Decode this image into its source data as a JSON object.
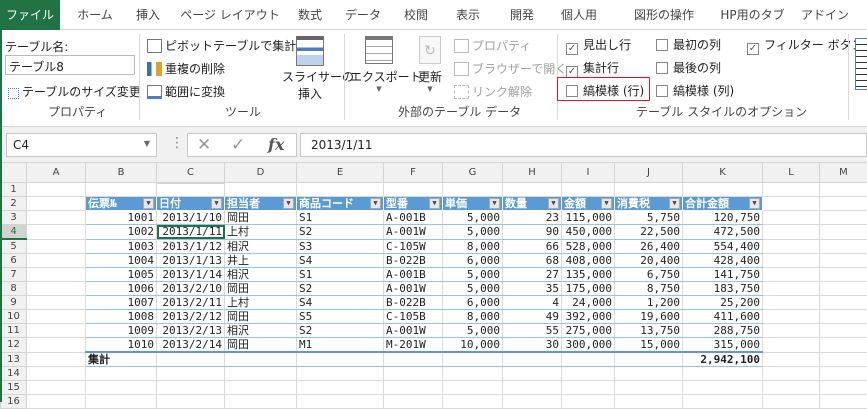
{
  "tabs": [
    "ファイル",
    "ホーム",
    "挿入",
    "ページ レイアウト",
    "数式",
    "データ",
    "校閲",
    "表示",
    "開発",
    "個人用",
    "図形の操作",
    "HP用のタブ",
    "アドイン"
  ],
  "ribbon": {
    "properties": {
      "table_name_label": "テーブル名:",
      "table_name_value": "テーブル8",
      "resize": "テーブルのサイズ変更",
      "group": "プロパティ"
    },
    "tools": {
      "pivot": "ピボットテーブルで集計",
      "dedupe": "重複の削除",
      "convert": "範囲に変換",
      "slicer_line1": "スライサーの",
      "slicer_line2": "挿入",
      "group": "ツール"
    },
    "external": {
      "export": "エクスポート",
      "refresh": "更新",
      "properties": "プロパティ",
      "open_browser": "ブラウザーで開く",
      "unlink": "リンク解除",
      "group": "外部のテーブル データ"
    },
    "style_options": {
      "header_row": {
        "label": "見出し行",
        "checked": true
      },
      "total_row": {
        "label": "集計行",
        "checked": true
      },
      "banded_rows": {
        "label": "縞模様 (行)",
        "checked": false
      },
      "first_column": {
        "label": "最初の列",
        "checked": false
      },
      "last_column": {
        "label": "最後の列",
        "checked": false
      },
      "banded_columns": {
        "label": "縞模様 (列)",
        "checked": false
      },
      "filter_button": {
        "label": "フィルター ボタン",
        "checked": true
      },
      "group": "テーブル スタイルのオプション"
    }
  },
  "formula_bar": {
    "name_box": "C4",
    "cancel": "✕",
    "enter": "✓",
    "fx": "fx",
    "formula": "2013/1/11"
  },
  "sheet": {
    "columns": [
      "A",
      "B",
      "C",
      "D",
      "E",
      "F",
      "G",
      "H",
      "I",
      "J",
      "K",
      "L",
      "M"
    ],
    "rows": [
      "1",
      "2",
      "3",
      "4",
      "5",
      "6",
      "7",
      "8",
      "9",
      "10",
      "11",
      "12",
      "13",
      "14",
      "15",
      "16"
    ],
    "table_headers": [
      "伝票№",
      "日付",
      "担当者",
      "商品コード",
      "型番",
      "単価",
      "数量",
      "金額",
      "消費税",
      "合計金額"
    ],
    "table_rows": [
      [
        "1001",
        "2013/1/10",
        "岡田",
        "S1",
        "A-001B",
        "5,000",
        "23",
        "115,000",
        "5,750",
        "120,750"
      ],
      [
        "1002",
        "2013/1/11",
        "上村",
        "S2",
        "A-001W",
        "5,000",
        "90",
        "450,000",
        "22,500",
        "472,500"
      ],
      [
        "1003",
        "2013/1/12",
        "相沢",
        "S3",
        "C-105W",
        "8,000",
        "66",
        "528,000",
        "26,400",
        "554,400"
      ],
      [
        "1004",
        "2013/1/13",
        "井上",
        "S4",
        "B-022B",
        "6,000",
        "68",
        "408,000",
        "20,400",
        "428,400"
      ],
      [
        "1005",
        "2013/1/14",
        "相沢",
        "S1",
        "A-001B",
        "5,000",
        "27",
        "135,000",
        "6,750",
        "141,750"
      ],
      [
        "1006",
        "2013/2/10",
        "岡田",
        "S2",
        "A-001W",
        "5,000",
        "35",
        "175,000",
        "8,750",
        "183,750"
      ],
      [
        "1007",
        "2013/2/11",
        "上村",
        "S4",
        "B-022B",
        "6,000",
        "4",
        "24,000",
        "1,200",
        "25,200"
      ],
      [
        "1008",
        "2013/2/12",
        "岡田",
        "S5",
        "C-105B",
        "8,000",
        "49",
        "392,000",
        "19,600",
        "411,600"
      ],
      [
        "1009",
        "2013/2/13",
        "相沢",
        "S2",
        "A-001W",
        "5,000",
        "55",
        "275,000",
        "13,750",
        "288,750"
      ],
      [
        "1010",
        "2013/2/14",
        "岡田",
        "M1",
        "M-201W",
        "10,000",
        "30",
        "300,000",
        "15,000",
        "315,000"
      ]
    ],
    "total_label": "集計",
    "total_value": "2,942,100"
  },
  "colors": {
    "accent": "#217346",
    "table_header": "#5b9bd5",
    "highlight": "#e81123"
  }
}
